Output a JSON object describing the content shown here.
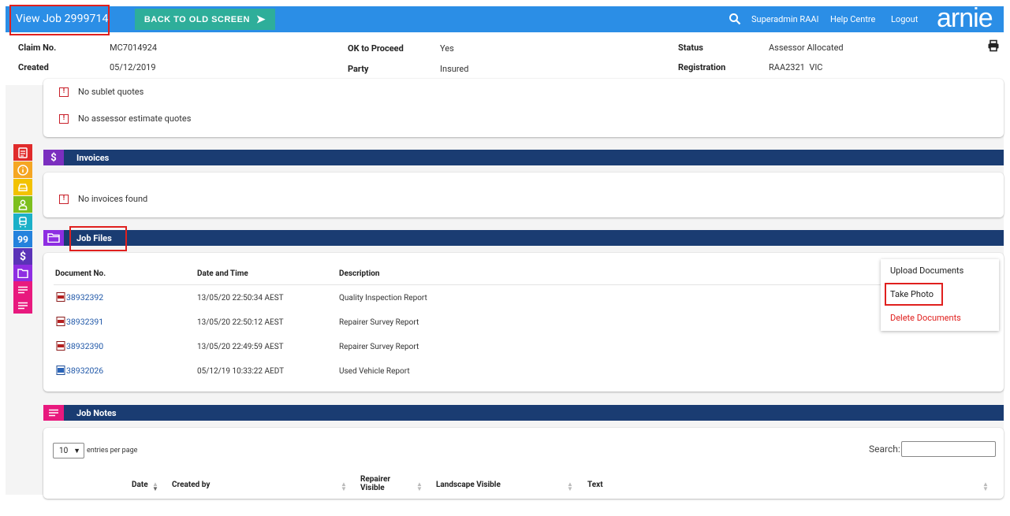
{
  "header": {
    "title": "View Job 2999714",
    "back_button": "BACK TO OLD SCREEN",
    "user": "Superadmin RAAI",
    "help": "Help Centre",
    "logout": "Logout",
    "logo": "arnie"
  },
  "job_info": {
    "claim_label": "Claim No.",
    "claim_value": "MC7014924",
    "created_label": "Created",
    "created_value": "05/12/2019",
    "ok_label": "OK to Proceed",
    "ok_value": "Yes",
    "party_label": "Party",
    "party_value": "Insured",
    "status_label": "Status",
    "status_value": "Assessor Allocated",
    "registration_label": "Registration",
    "registration_value": "RAA2321  VIC"
  },
  "quotes": {
    "sublet": "No sublet quotes",
    "assessor": "No assessor estimate quotes"
  },
  "invoices": {
    "title": "Invoices",
    "empty": "No invoices found"
  },
  "job_files": {
    "title": "Job Files",
    "columns": {
      "doc": "Document No.",
      "date": "Date and Time",
      "desc": "Description"
    },
    "rows": [
      {
        "doc": "38932392",
        "date": "13/05/20 22:50:34 AEST",
        "desc": "Quality Inspection Report"
      },
      {
        "doc": "38932391",
        "date": "13/05/20 22:50:12 AEST",
        "desc": "Repairer Survey Report"
      },
      {
        "doc": "38932390",
        "date": "13/05/20 22:49:59 AEST",
        "desc": "Repairer Survey Report"
      },
      {
        "doc": "38932026",
        "date": "05/12/19 10:33:22 AEDT",
        "desc": "Used Vehicle Report"
      }
    ],
    "menu": {
      "upload": "Upload Documents",
      "photo": "Take Photo",
      "delete": "Delete Documents"
    }
  },
  "job_notes": {
    "title": "Job Notes",
    "entries_value": "10",
    "entries_label": "entries per page",
    "search_label": "Search:",
    "columns": {
      "date": "Date",
      "created_by": "Created by",
      "repairer_visible_1": "Repairer",
      "repairer_visible_2": "Visible",
      "landscape": "Landscape Visible",
      "text": "Text"
    }
  },
  "colors": {
    "topbar": "#2b8ee6",
    "back_button": "#2eae9a",
    "section_bar": "#1a3c72",
    "highlight": "#e0201e"
  }
}
